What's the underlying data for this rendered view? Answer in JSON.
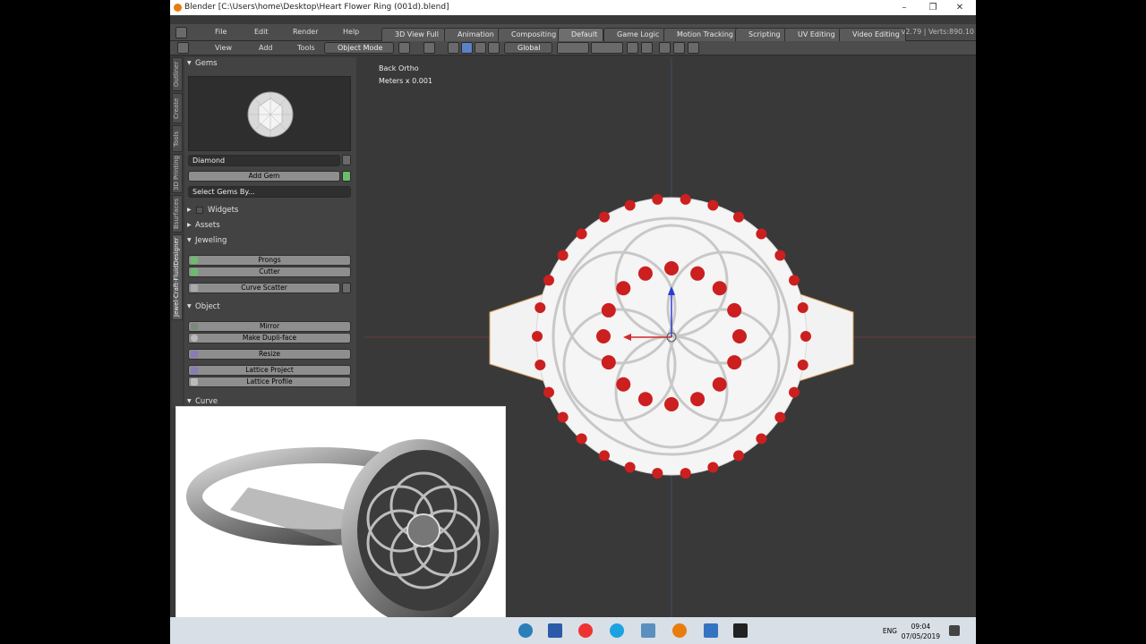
{
  "window": {
    "title": "Blender [C:\\Users\\home\\Desktop\\Heart Flower Ring (001d).blend]"
  },
  "menus": {
    "file": "File",
    "edit": "Edit",
    "render": "Render",
    "help": "Help"
  },
  "workspace_tabs": [
    "3D View Full",
    "Animation",
    "Compositing",
    "Default",
    "Game Logic",
    "Motion Tracking",
    "Scripting",
    "UV Editing",
    "Video Editing"
  ],
  "stats": "v2.79 | Verts:890.10",
  "toolbar": {
    "view": "View",
    "add": "Add",
    "tools": "Tools",
    "mode": "Object Mode",
    "orientation": "Global"
  },
  "side_tabs": [
    "Outliner",
    "Create",
    "Tools",
    "3D Printing",
    "Bsurfaces",
    "Jewel-Craft-FluidDesigner"
  ],
  "shelf": {
    "gems_title": "Gems",
    "gem_type": "Diamond",
    "add_gem": "Add Gem",
    "select_by": "Select Gems By...",
    "widgets": "Widgets",
    "assets": "Assets",
    "jeweling": "Jeweling",
    "prongs": "Prongs",
    "cutter": "Cutter",
    "curve_scatter": "Curve Scatter",
    "object": "Object",
    "mirror": "Mirror",
    "dupli_face": "Make Dupli-face",
    "resize": "Resize",
    "lattice_project": "Lattice Project",
    "lattice_profile": "Lattice Profile",
    "curve": "Curve"
  },
  "viewport": {
    "view_name": "Back Ortho",
    "units": "Meters x 0.001"
  },
  "taskbar": {
    "lang": "ENG",
    "time": "09:04",
    "date": "07/05/2019"
  },
  "colors": {
    "gem_red": "#cc1f1f",
    "ring_white": "#f4f4f4",
    "blender_orange": "#e87d0d"
  }
}
